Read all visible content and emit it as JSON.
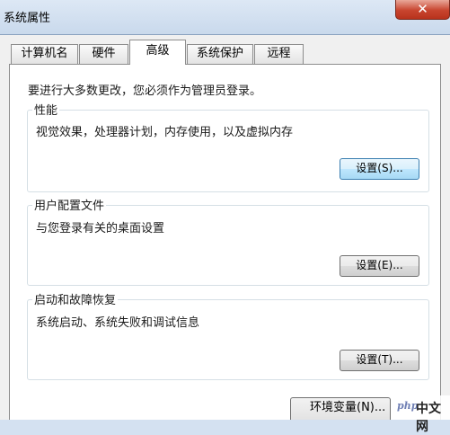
{
  "window": {
    "title": "系统属性",
    "close_label": "✕"
  },
  "tabs": [
    {
      "label": "计算机名",
      "active": false
    },
    {
      "label": "硬件",
      "active": false
    },
    {
      "label": "高级",
      "active": true
    },
    {
      "label": "系统保护",
      "active": false
    },
    {
      "label": "远程",
      "active": false
    }
  ],
  "notice": "要进行大多数更改，您必须作为管理员登录。",
  "groups": {
    "performance": {
      "title": "性能",
      "description": "视觉效果，处理器计划，内存使用，以及虚拟内存",
      "button": "设置(S)..."
    },
    "user_profiles": {
      "title": "用户配置文件",
      "description": "与您登录有关的桌面设置",
      "button": "设置(E)..."
    },
    "startup_recovery": {
      "title": "启动和故障恢复",
      "description": "系统启动、系统失败和调试信息",
      "button": "设置(T)..."
    }
  },
  "footer": {
    "env_button": "环境变量(N)..."
  },
  "watermark": {
    "logo_text": "php",
    "site_text": "中文网"
  },
  "colors": {
    "focus_button_border": "#3c7fb1",
    "close_button": "#c8452f"
  }
}
